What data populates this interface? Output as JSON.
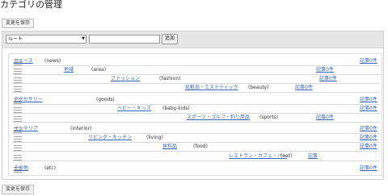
{
  "page": {
    "title": "カテゴリの管理"
  },
  "toolbar": {
    "save_label": "変更を保存",
    "parent_select": {
      "value": "ルート"
    },
    "new_category_input": {
      "value": ""
    },
    "add_label": "追加"
  },
  "categories": [
    {
      "name": "ニュース",
      "slug": "(news)",
      "count": "記事0件"
    },
    {
      "name": "地域",
      "slug": "(area)",
      "count": "記事0件"
    },
    {
      "name": "ファッション",
      "slug": "(fashion)",
      "count": "記事0件"
    },
    {
      "name": "化粧品・エステティック",
      "slug": "(beauty)",
      "count": "記事0件"
    },
    {
      "name": "アクセサリー",
      "slug": "(goods)",
      "count": "記事0件"
    },
    {
      "name": "ベビー・キッズ",
      "slug": "(baby-kids)",
      "count": "記事0件"
    },
    {
      "name": "スポーツ・ゴルフ・釣り用品",
      "slug": "(sports)",
      "count": "記事0件"
    },
    {
      "name": "インテリア",
      "slug": "(interior)",
      "count": "記事0件"
    },
    {
      "name": "リビング・キッチン",
      "slug": "(living)",
      "count": "記事0件"
    },
    {
      "name": "食料品",
      "slug": "(food)",
      "count": "記事0件"
    },
    {
      "name": "レストラン・カフェ・バー",
      "slug": "(eat)",
      "count": "記事"
    },
    {
      "name": "その他",
      "slug": "(etc)",
      "count": "記事0件"
    }
  ]
}
